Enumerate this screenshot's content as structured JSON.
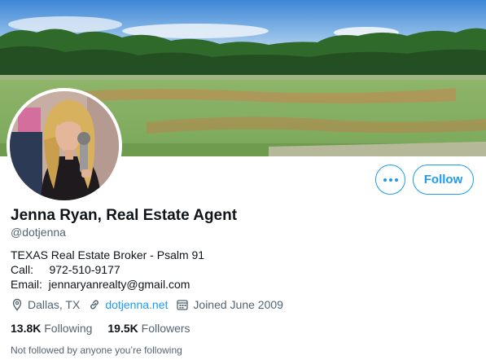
{
  "profile": {
    "display_name": "Jenna Ryan, Real Estate Agent",
    "handle": "@dotjenna",
    "bio_lines": [
      "TEXAS Real Estate Broker - Psalm 91",
      "Call:     972-510-9177",
      "Email:  jennaryanrealty@gmail.com"
    ],
    "location": "Dallas, TX",
    "website": "dotjenna.net",
    "joined": "Joined June 2009",
    "following_count": "13.8K",
    "following_label": "Following",
    "followers_count": "19.5K",
    "followers_label": "Followers",
    "mutual_note": "Not followed by anyone you’re following"
  },
  "actions": {
    "follow_label": "Follow"
  },
  "icons": {
    "location": "location-pin-icon",
    "link": "link-icon",
    "calendar": "calendar-icon",
    "more": "more-options-icon"
  },
  "colors": {
    "accent": "#1d9bf0",
    "text_primary": "#0f1419",
    "text_secondary": "#536471"
  }
}
